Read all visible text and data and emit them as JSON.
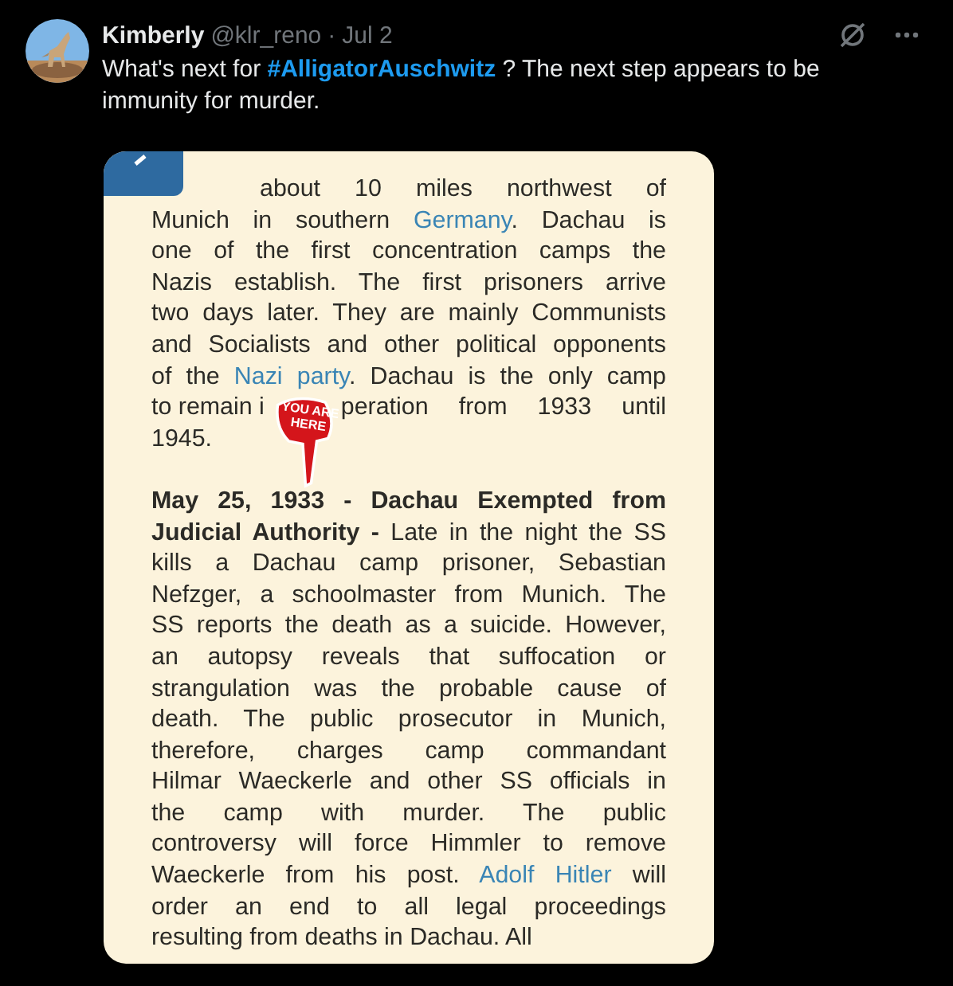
{
  "post": {
    "author": "Kimberly",
    "handle": "@klr_reno",
    "separator": "·",
    "date": "Jul 2",
    "text": [
      {
        "kind": "text",
        "text": "What's next for "
      },
      {
        "kind": "hashtag",
        "text": "#AlligatorAuschwitz"
      },
      {
        "kind": "text",
        "text": " ?  The next step appears to be immunity for murder."
      }
    ]
  },
  "document": {
    "sticker": [
      "YOU ARE",
      "HERE"
    ],
    "paragraphs": [
      [
        [
          {
            "kind": "text",
            "text": "about 10 miles northwest of"
          }
        ],
        [
          {
            "kind": "text",
            "text": "Munich in southern "
          },
          {
            "kind": "link",
            "text": "Germany"
          },
          {
            "kind": "text",
            "text": ". Dachau is"
          }
        ],
        [
          {
            "kind": "text",
            "text": "one of the first concentration camps the"
          }
        ],
        [
          {
            "kind": "text",
            "text": "Nazis establish. The first prisoners arrive"
          }
        ],
        [
          {
            "kind": "text",
            "text": "two days later. They are mainly Communists"
          }
        ],
        [
          {
            "kind": "text",
            "text": "and Socialists and other political opponents"
          }
        ],
        [
          {
            "kind": "text",
            "text": "of the "
          },
          {
            "kind": "link",
            "text": "Nazi party"
          },
          {
            "kind": "text",
            "text": ". Dachau is the only camp"
          }
        ],
        [
          {
            "kind": "text",
            "text": "to remain i"
          },
          {
            "kind": "covered"
          },
          {
            "kind": "text",
            "text": "peration from 1933 until"
          }
        ],
        [
          {
            "kind": "text",
            "text": "1945."
          }
        ]
      ],
      [
        [
          {
            "kind": "bold",
            "text": "May 25, 1933 - Dachau Exempted from"
          }
        ],
        [
          {
            "kind": "bold",
            "text": "Judicial Authority -"
          },
          {
            "kind": "text",
            "text": " Late in the night the SS"
          }
        ],
        [
          {
            "kind": "text",
            "text": "kills a Dachau camp prisoner, Sebastian"
          }
        ],
        [
          {
            "kind": "text",
            "text": "Nefzger, a schoolmaster from Munich. The"
          }
        ],
        [
          {
            "kind": "text",
            "text": "SS reports the death as a suicide. However,"
          }
        ],
        [
          {
            "kind": "text",
            "text": "an autopsy reveals that suffocation or"
          }
        ],
        [
          {
            "kind": "text",
            "text": "strangulation was the probable cause of"
          }
        ],
        [
          {
            "kind": "text",
            "text": "death. The public prosecutor in Munich,"
          }
        ],
        [
          {
            "kind": "text",
            "text": "therefore, charges camp commandant"
          }
        ],
        [
          {
            "kind": "text",
            "text": "Hilmar Waeckerle and other SS officials in"
          }
        ],
        [
          {
            "kind": "text",
            "text": "the camp with murder. The public"
          }
        ],
        [
          {
            "kind": "text",
            "text": "controversy will force Himmler to remove"
          }
        ],
        [
          {
            "kind": "text",
            "text": "Waeckerle from his post. "
          },
          {
            "kind": "link",
            "text": "Adolf Hitler"
          },
          {
            "kind": "text",
            "text": " will"
          }
        ],
        [
          {
            "kind": "text",
            "text": "order an end to all legal proceedings"
          }
        ],
        [
          {
            "kind": "text",
            "text": "resulting from deaths in Dachau. All"
          }
        ]
      ]
    ]
  }
}
